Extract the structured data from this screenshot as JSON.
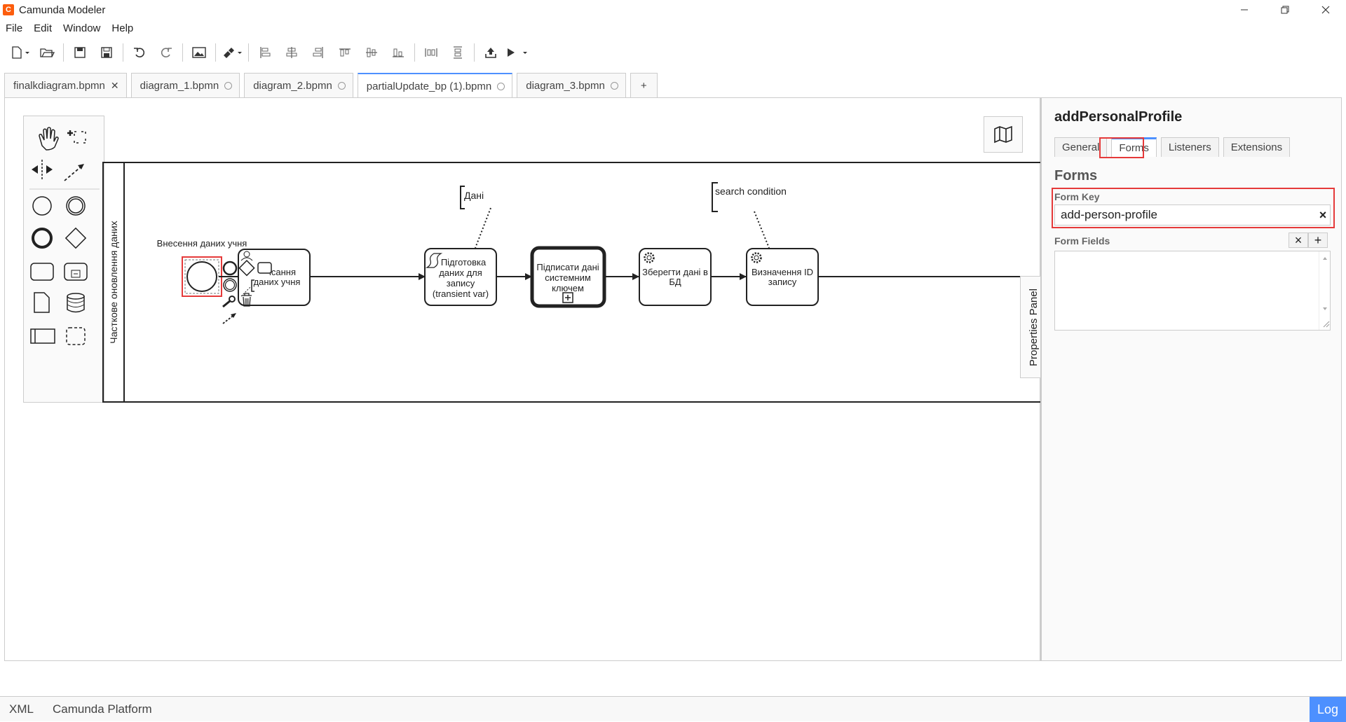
{
  "app": {
    "logo_letter": "C",
    "title": "Camunda Modeler"
  },
  "menu": [
    "File",
    "Edit",
    "Window",
    "Help"
  ],
  "toolbar_icons": [
    "new-file-icon",
    "open-folder-icon",
    "save-icon",
    "save-as-icon",
    "undo-icon",
    "redo-icon",
    "image-export-icon",
    "color-brush-icon",
    "align-left-icon",
    "align-center-icon",
    "align-right-icon",
    "align-top-icon",
    "align-middle-icon",
    "align-bottom-icon",
    "distribute-horizontal-icon",
    "distribute-vertical-icon",
    "deploy-icon",
    "run-icon"
  ],
  "tabs": [
    {
      "label": "finalkdiagram.bpmn",
      "state": "closable"
    },
    {
      "label": "diagram_1.bpmn",
      "state": "saved"
    },
    {
      "label": "diagram_2.bpmn",
      "state": "saved"
    },
    {
      "label": "partialUpdate_bp (1).bpmn",
      "state": "active"
    },
    {
      "label": "diagram_3.bpmn",
      "state": "saved"
    }
  ],
  "new_tab_label": "+",
  "diagram": {
    "pool_label": "Часткове оновлення даних",
    "start_event_label": "Внесення даних учня",
    "annotation_1": "Дані",
    "annotation_2": "search condition",
    "task_1_line1": "ісання",
    "task_1_line2": "даних учня",
    "task_2": [
      "Підготовка",
      "даних для",
      "запису",
      "(transient var)"
    ],
    "task_3": [
      "Підписати дані",
      "системним",
      "ключем"
    ],
    "task_4": [
      "Зберегти дані в",
      "БД"
    ],
    "task_5": [
      "Визначення ID",
      "запису"
    ]
  },
  "properties_toggle": "Properties Panel",
  "panel": {
    "title": "addPersonalProfile",
    "tabs": [
      "General",
      "Forms",
      "Listeners",
      "Extensions"
    ],
    "active_tab": "Forms",
    "section_title": "Forms",
    "form_key_label": "Form Key",
    "form_key_value": "add-person-profile",
    "clear_symbol": "×",
    "form_fields_label": "Form Fields",
    "remove_symbol": "×",
    "add_symbol": "+"
  },
  "status": {
    "xml": "XML",
    "platform": "Camunda Platform",
    "log": "Log"
  },
  "colors": {
    "accent": "#4d90ff",
    "highlight": "#e53a3a",
    "brand": "#fc5d0d"
  }
}
